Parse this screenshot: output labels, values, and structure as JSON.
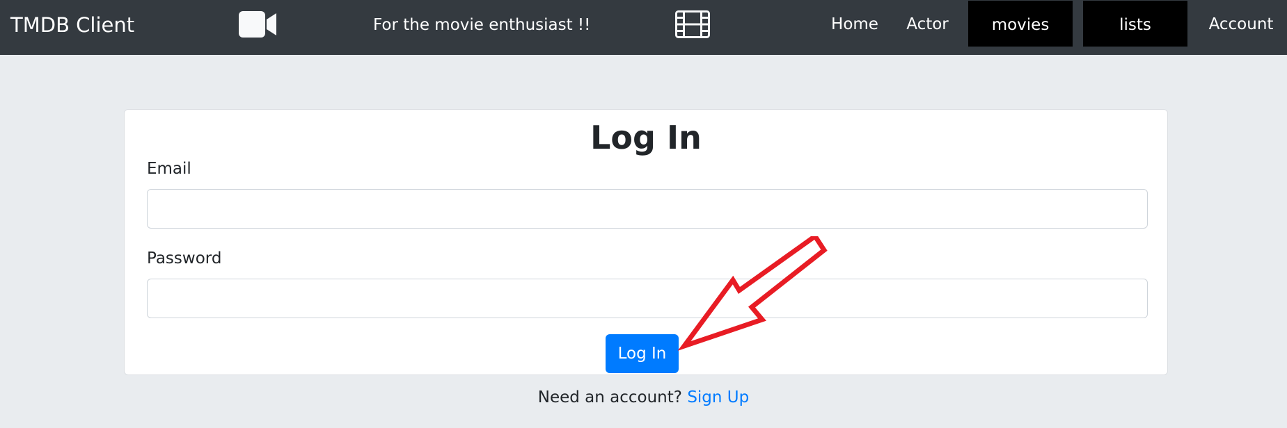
{
  "navbar": {
    "brand": "TMDB Client",
    "camera_icon": "video-camera-icon",
    "tagline": "For the movie enthusiast !!",
    "film_icon": "film-strip-icon",
    "links": {
      "home": "Home",
      "actor": "Actor",
      "movies": "movies",
      "lists": "lists",
      "account": "Account"
    }
  },
  "login_card": {
    "title": "Log In",
    "email_label": "Email",
    "email_value": "",
    "password_label": "Password",
    "password_value": "",
    "submit_label": "Log In"
  },
  "footer": {
    "prompt": "Need an account?",
    "signup_link": "Sign Up"
  },
  "annotation": {
    "arrow_icon": "red-arrow-annotation-icon",
    "arrow_color": "#e81c24"
  },
  "colors": {
    "navbar_bg": "#343a40",
    "page_bg": "#e9ecef",
    "primary": "#007bff"
  }
}
